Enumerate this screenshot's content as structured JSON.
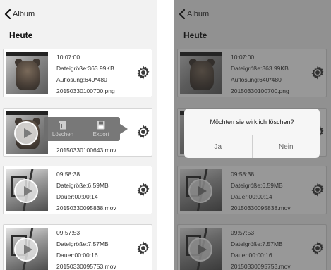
{
  "screens": [
    {
      "nav": {
        "back_label": "Album"
      },
      "section_title": "Heute",
      "items": [
        {
          "line1": "10:07:00",
          "line2": "Dateigröße:363.99KB",
          "line3": "Auflösung:640*480",
          "line4": "20150330100700.png",
          "thumb": "teddy-bear-photo",
          "play": false
        },
        {
          "line1": "",
          "line2": "",
          "line3": "",
          "line4": "20150330100643.mov",
          "thumb": "teddy-bear-video",
          "play": true
        },
        {
          "line1": "09:58:38",
          "line2": "Dateigröße:6.59MB",
          "line3": "Dauer:00:00:14",
          "line4": "20150330095838.mov",
          "thumb": "room-video",
          "play": true
        },
        {
          "line1": "09:57:53",
          "line2": "Dateigröße:7.57MB",
          "line3": "Dauer:00:00:16",
          "line4": "20150330095753.mov",
          "thumb": "room-video",
          "play": true
        }
      ],
      "popup": {
        "delete_label": "Löschen",
        "export_label": "Export",
        "delete_icon": "trash-icon",
        "export_icon": "save-icon"
      }
    },
    {
      "nav": {
        "back_label": "Album"
      },
      "section_title": "Heute",
      "items": [
        {
          "line1": "10:07:00",
          "line2": "Dateigröße:363.99KB",
          "line3": "Auflösung:640*480",
          "line4": "20150330100700.png",
          "thumb": "teddy-bear-photo",
          "play": false
        },
        {
          "line1": "",
          "line2": "",
          "line3": "",
          "line4": "",
          "thumb": "teddy-bear-video",
          "play": true
        },
        {
          "line1": "09:58:38",
          "line2": "Dateigröße:6.59MB",
          "line3": "Dauer:00:00:14",
          "line4": "20150330095838.mov",
          "thumb": "room-video",
          "play": true
        },
        {
          "line1": "09:57:53",
          "line2": "Dateigröße:7.57MB",
          "line3": "Dauer:00:00:16",
          "line4": "20150330095753.mov",
          "thumb": "room-video",
          "play": true
        }
      ],
      "dialog": {
        "message": "Möchten sie wirklich löschen?",
        "yes_label": "Ja",
        "no_label": "Nein"
      }
    }
  ],
  "colors": {
    "background": "#f2f2f2",
    "card": "#ffffff",
    "popup": "#6e6e6e",
    "overlay": "#282828"
  },
  "icons": {
    "back": "chevron-left-icon",
    "settings": "gear-icon",
    "play": "play-icon"
  }
}
